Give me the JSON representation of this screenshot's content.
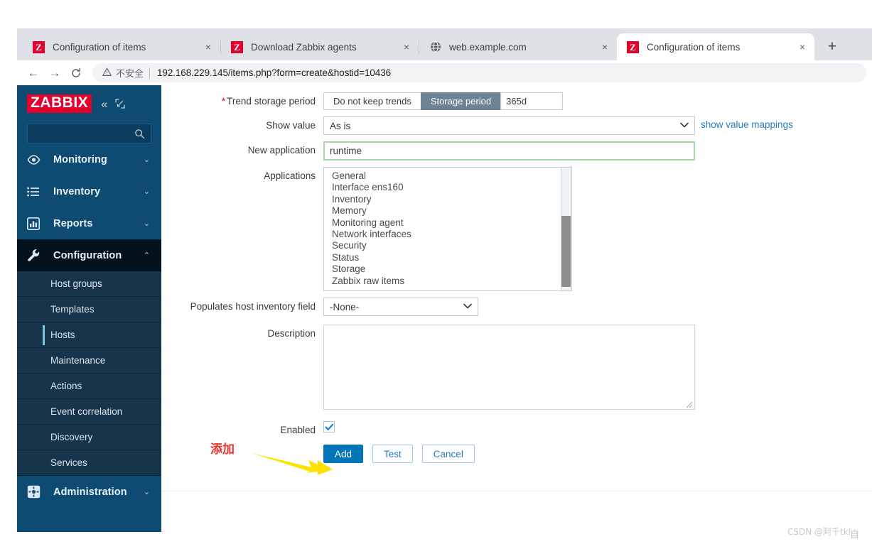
{
  "browser": {
    "tabs": [
      {
        "title": "Configuration of items",
        "favicon": "zabbix-icon",
        "active": false
      },
      {
        "title": "Download Zabbix agents",
        "favicon": "zabbix-icon",
        "active": false
      },
      {
        "title": "web.example.com",
        "favicon": "globe-icon",
        "active": false
      },
      {
        "title": "Configuration of items",
        "favicon": "zabbix-icon",
        "active": true
      }
    ],
    "close_label": "×",
    "newtab_label": "+",
    "back_label": "←",
    "forward_label": "→",
    "reload_label": "⟳",
    "omnibox": {
      "warn_icon": "warning-triangle-icon",
      "security_label": "不安全",
      "url_host": "192.168.229.145",
      "url_path": "/items.php?form=create&hostid=10436"
    }
  },
  "sidebar": {
    "logo": "ZABBIX",
    "collapse_label": "«",
    "expand_icon": "expand-icon",
    "search_placeholder": "",
    "search_icon": "search-icon",
    "items": [
      {
        "label": "Monitoring",
        "icon": "eye-icon",
        "caret": "⌄",
        "expanded": false
      },
      {
        "label": "Inventory",
        "icon": "list-icon",
        "caret": "⌄",
        "expanded": false
      },
      {
        "label": "Reports",
        "icon": "bar-chart-icon",
        "caret": "⌄",
        "expanded": false
      },
      {
        "label": "Configuration",
        "icon": "wrench-icon",
        "caret": "⌃",
        "expanded": true
      },
      {
        "label": "Administration",
        "icon": "gear-icon",
        "caret": "⌄",
        "expanded": false
      }
    ],
    "configuration_submenu": [
      {
        "label": "Host groups",
        "selected": false
      },
      {
        "label": "Templates",
        "selected": false
      },
      {
        "label": "Hosts",
        "selected": true
      },
      {
        "label": "Maintenance",
        "selected": false
      },
      {
        "label": "Actions",
        "selected": false
      },
      {
        "label": "Event correlation",
        "selected": false
      },
      {
        "label": "Discovery",
        "selected": false
      },
      {
        "label": "Services",
        "selected": false
      }
    ]
  },
  "form": {
    "trend_storage": {
      "label": "Trend storage period",
      "required_mark": "*",
      "options": [
        "Do not keep trends",
        "Storage period"
      ],
      "selected": "Storage period",
      "value": "365d"
    },
    "show_value": {
      "label": "Show value",
      "value": "As is",
      "chevron": "⌄",
      "link_label": "show value mappings"
    },
    "new_application": {
      "label": "New application",
      "value": "runtime",
      "placeholder": ""
    },
    "applications": {
      "label": "Applications",
      "options": [
        "General",
        "Interface ens160",
        "Inventory",
        "Memory",
        "Monitoring agent",
        "Network interfaces",
        "Security",
        "Status",
        "Storage",
        "Zabbix raw items"
      ]
    },
    "inventory_field": {
      "label": "Populates host inventory field",
      "value": "-None-",
      "chevron": "⌄"
    },
    "description": {
      "label": "Description",
      "value": "",
      "placeholder": ""
    },
    "enabled": {
      "label": "Enabled",
      "checked": true,
      "check_icon": "check-icon"
    },
    "buttons": {
      "add": "Add",
      "test": "Test",
      "cancel": "Cancel"
    }
  },
  "annotations": {
    "chinese_note": "添加",
    "arrow": "yellow-arrow-icon",
    "note_color": "#e8342a",
    "arrow_color": "#ffe100"
  },
  "watermark": {
    "text": "CSDN @阿千tkl",
    "mark": "自"
  }
}
